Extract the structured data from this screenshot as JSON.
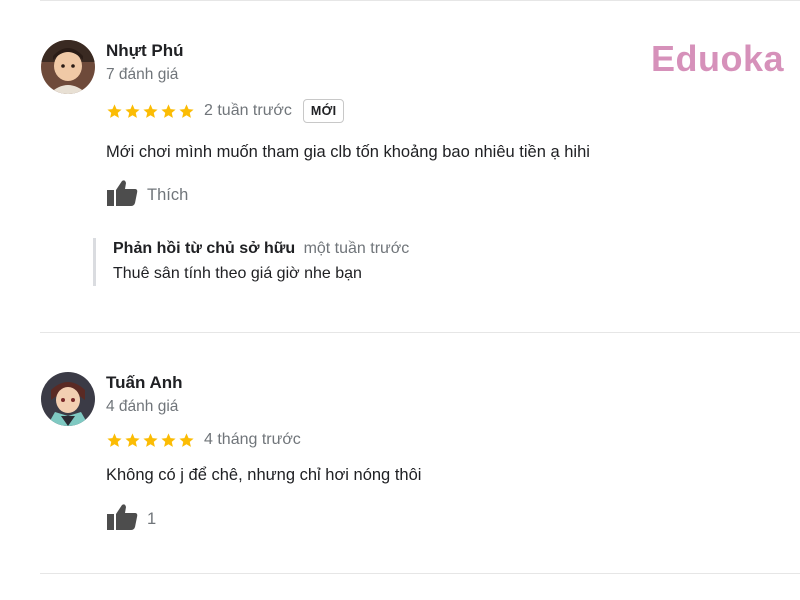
{
  "brand": {
    "logo_text": "Eduoka",
    "color": "#d691ba"
  },
  "colors": {
    "star": "#fbbc04",
    "muted_text": "#70757a",
    "text": "#202124",
    "divider": "#e6e6e6"
  },
  "reviews": [
    {
      "reviewer": "Nhựt Phú",
      "review_count": "7 đánh giá",
      "stars": 5,
      "time": "2 tuần trước",
      "badge": "MỚI",
      "text": "Mới chơi mình muốn tham gia clb tốn khoảng bao nhiêu tiền ạ hihi",
      "like_label": "Thích",
      "owner_reply": {
        "title": "Phản hồi từ chủ sở hữu",
        "time": "một tuần trước",
        "text": "Thuê sân tính theo giá giờ nhe bạn"
      }
    },
    {
      "reviewer": "Tuấn Anh",
      "review_count": "4 đánh giá",
      "stars": 5,
      "time": "4 tháng trước",
      "text": "Không có j để chê, nhưng chỉ hơi nóng thôi",
      "like_label": "1"
    }
  ]
}
